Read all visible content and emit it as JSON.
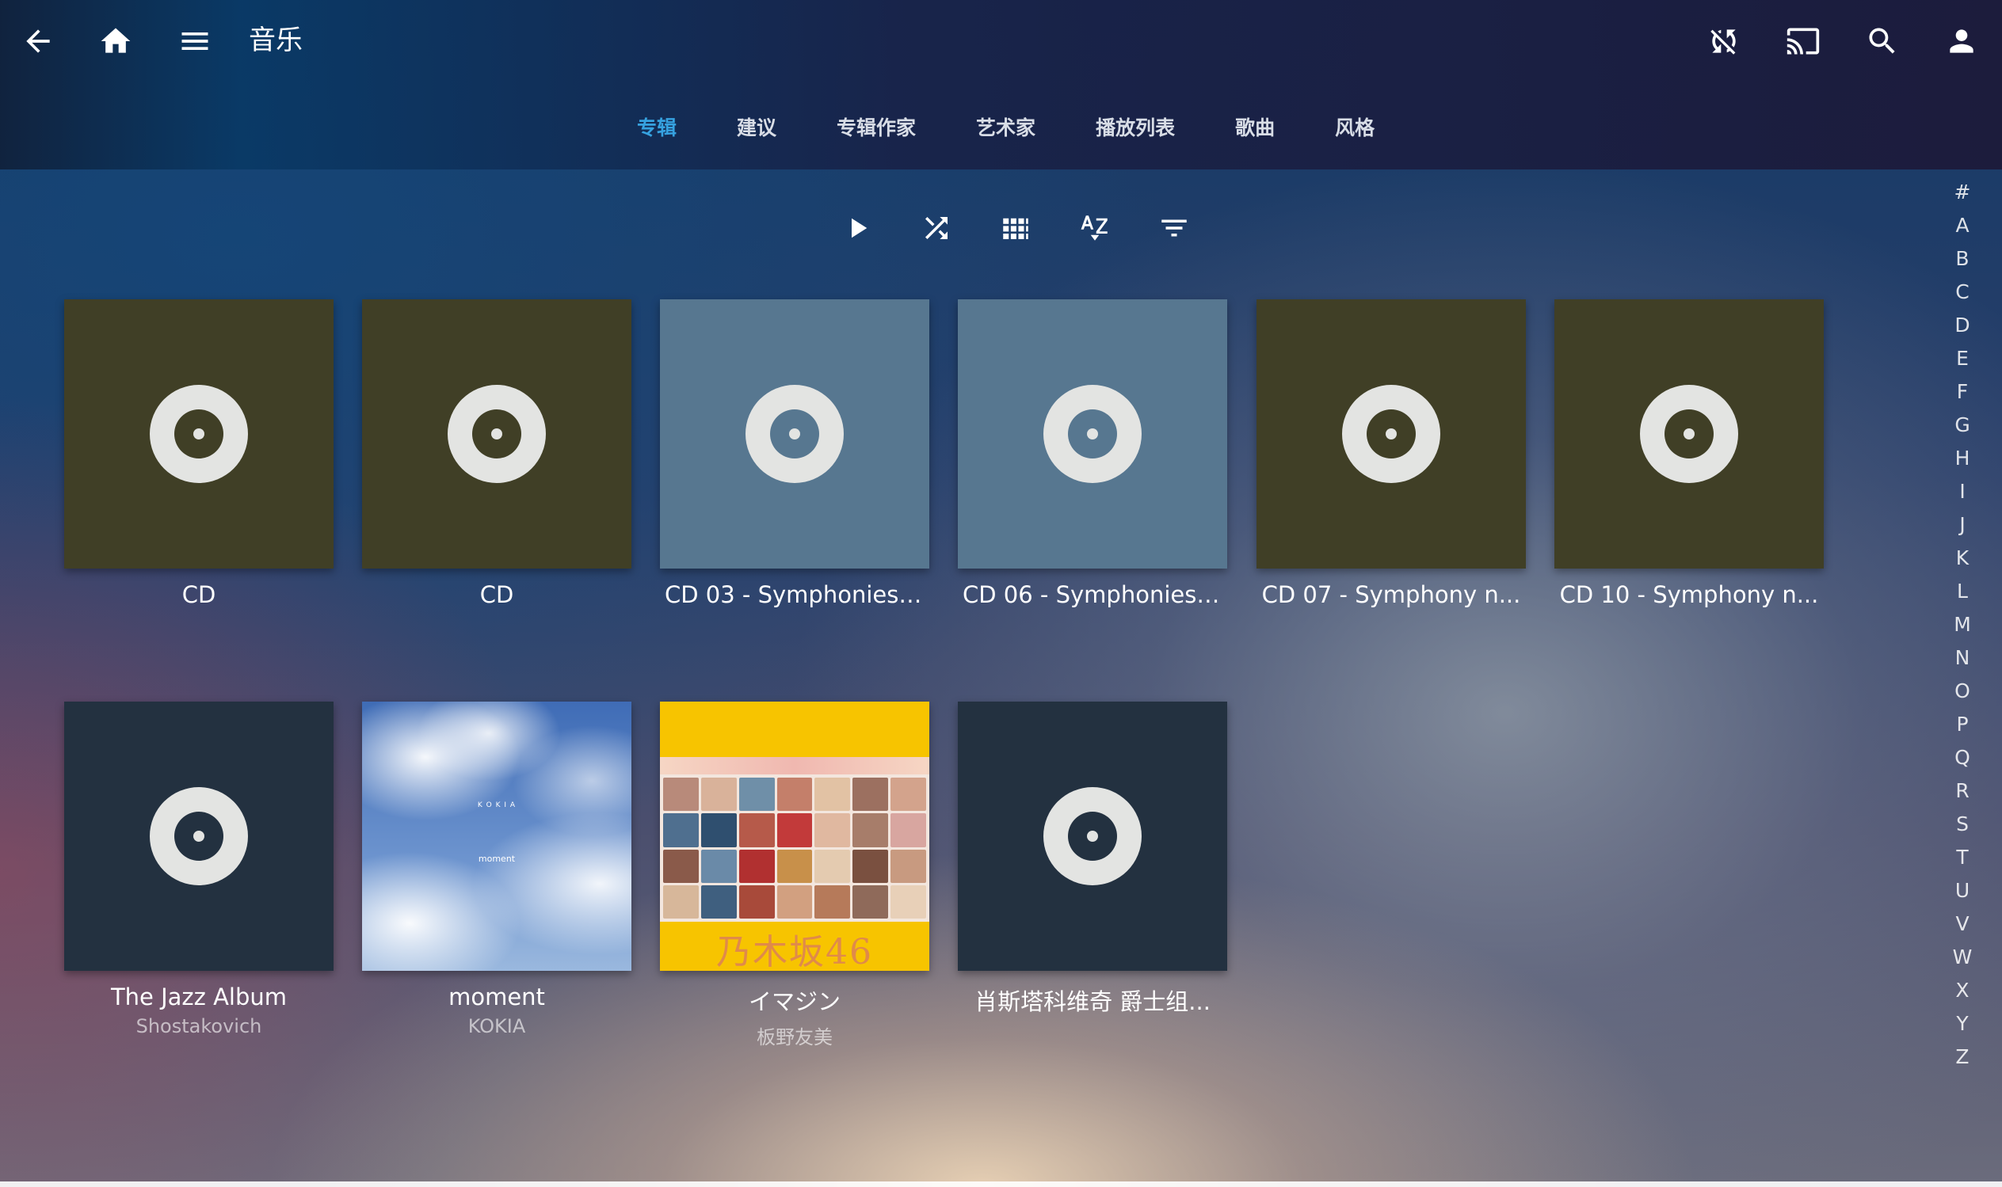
{
  "header": {
    "title": "音乐",
    "left_icons": [
      "back-arrow-icon",
      "home-icon",
      "menu-icon"
    ],
    "right_icons": [
      "sync-off-icon",
      "cast-icon",
      "search-icon",
      "user-icon"
    ]
  },
  "tabs": [
    {
      "label": "专辑",
      "active": true
    },
    {
      "label": "建议",
      "active": false
    },
    {
      "label": "专辑作家",
      "active": false
    },
    {
      "label": "艺术家",
      "active": false
    },
    {
      "label": "播放列表",
      "active": false
    },
    {
      "label": "歌曲",
      "active": false
    },
    {
      "label": "风格",
      "active": false
    }
  ],
  "toolbar": [
    "play-icon",
    "shuffle-icon",
    "grid-view-icon",
    "sort-az-icon",
    "filter-icon"
  ],
  "albums": [
    {
      "title": "CD",
      "artist": "",
      "cover": "olive"
    },
    {
      "title": "CD",
      "artist": "",
      "cover": "olive"
    },
    {
      "title": "CD 03 - Symphonies ...",
      "artist": "",
      "cover": "slate"
    },
    {
      "title": "CD 06 - Symphonies ...",
      "artist": "",
      "cover": "slate"
    },
    {
      "title": "CD 07 - Symphony n...",
      "artist": "",
      "cover": "olive"
    },
    {
      "title": "CD 10 - Symphony n...",
      "artist": "",
      "cover": "olive"
    },
    {
      "title": "The Jazz Album",
      "artist": "Shostakovich",
      "cover": "navy"
    },
    {
      "title": "moment",
      "artist": "KOKIA",
      "cover": "art-sky",
      "cover_text": [
        "K O K I A",
        "moment"
      ]
    },
    {
      "title": "イマジン",
      "artist": "板野友美",
      "cover": "art-nogizaka",
      "cover_text": "乃木坂46"
    },
    {
      "title": "肖斯塔科维奇 爵士组...",
      "artist": "",
      "cover": "navy"
    }
  ],
  "alphabet": [
    "#",
    "A",
    "B",
    "C",
    "D",
    "E",
    "F",
    "G",
    "H",
    "I",
    "J",
    "K",
    "L",
    "M",
    "N",
    "O",
    "P",
    "Q",
    "R",
    "S",
    "T",
    "U",
    "V",
    "W",
    "X",
    "Y",
    "Z"
  ],
  "colors": {
    "accent": "#36a2e0",
    "olive_cover": "#403f26",
    "slate_cover": "#577790",
    "navy_cover": "#233140",
    "nogizaka_cover": "#f7c400"
  }
}
